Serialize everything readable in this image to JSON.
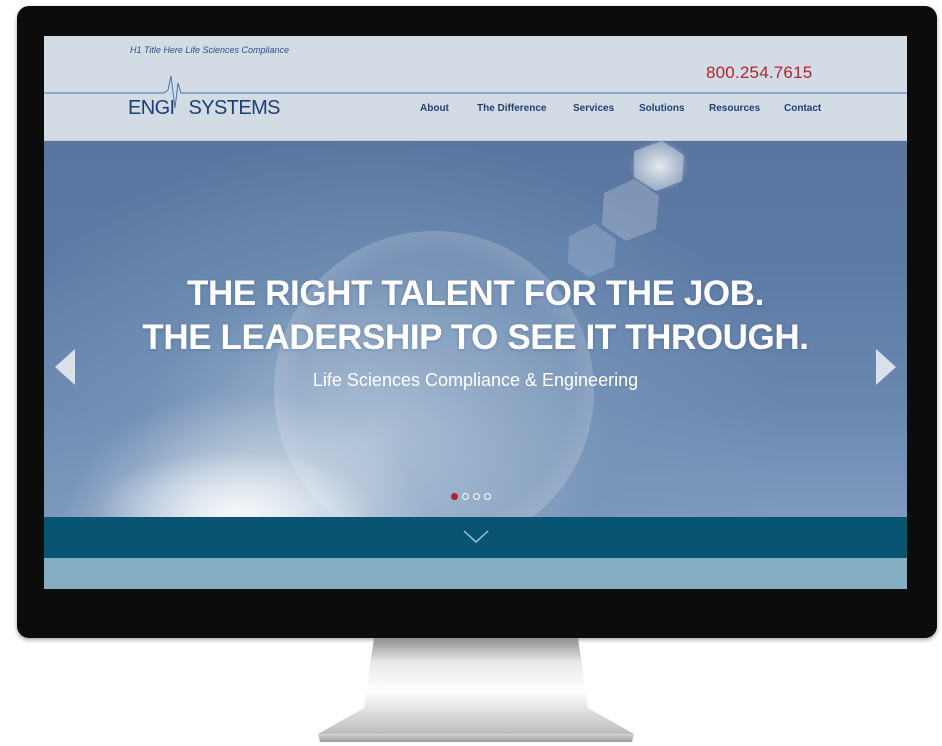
{
  "header": {
    "h1_title": "H1 Title Here Life Sciences Compliance",
    "phone": "800.254.7615",
    "logo": {
      "left": "ENGI",
      "right": "SYSTEMS"
    }
  },
  "nav": {
    "items": [
      {
        "label": "About"
      },
      {
        "label": "The Difference"
      },
      {
        "label": "Services"
      },
      {
        "label": "Solutions"
      },
      {
        "label": "Resources"
      },
      {
        "label": "Contact"
      }
    ]
  },
  "hero": {
    "headline_line1": "THE RIGHT TALENT FOR THE JOB.",
    "headline_line2": "THE LEADERSHIP TO SEE IT THROUGH.",
    "subheadline": "Life Sciences Compliance & Engineering",
    "prev_icon": "chevron-left-icon",
    "next_icon": "chevron-right-icon",
    "slides_total": 4,
    "active_slide": 1
  },
  "band": {
    "scroll_icon": "chevron-down-icon"
  },
  "colors": {
    "accent_red": "#b2232f",
    "navy": "#1f3f73",
    "header_bg": "#d3dce5",
    "band_dark": "#095373",
    "band_light": "#86aec3"
  }
}
